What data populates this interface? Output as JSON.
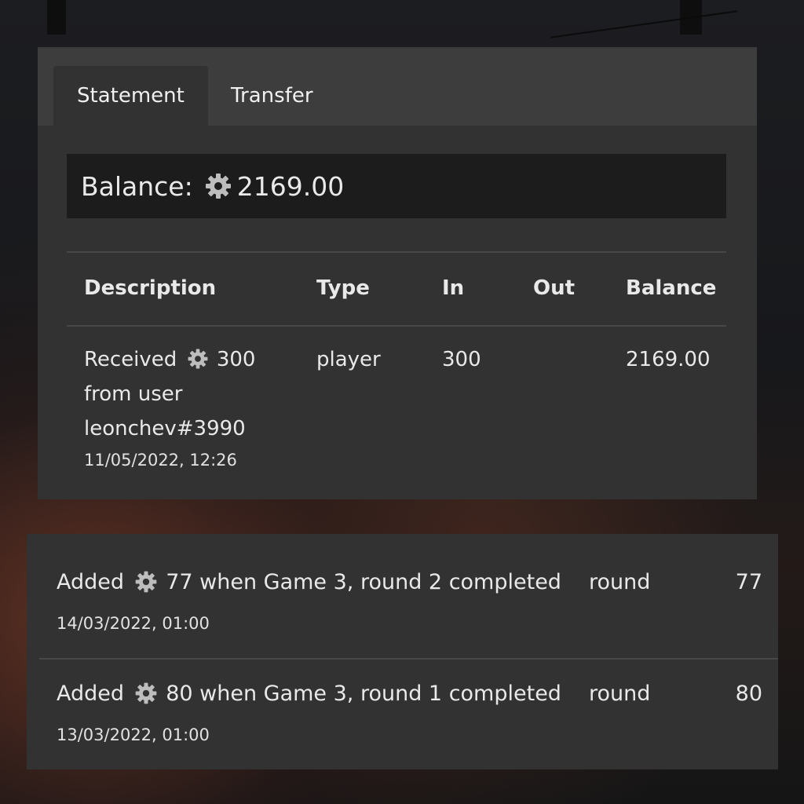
{
  "tabs": [
    {
      "label": "Statement",
      "active": true
    },
    {
      "label": "Transfer",
      "active": false
    }
  ],
  "balance": {
    "label": "Balance:",
    "icon": "gear-coin-icon",
    "amount": "2169.00"
  },
  "table": {
    "headers": {
      "description": "Description",
      "type": "Type",
      "in": "In",
      "out": "Out",
      "balance": "Balance"
    },
    "rows": [
      {
        "desc_prefix": "Received",
        "amount": "300",
        "desc_line2": "from user",
        "desc_line3": "leonchev#3990",
        "date": "11/05/2022, 12:26",
        "type": "player",
        "in": "300",
        "out": "",
        "balance": "2169.00"
      },
      {
        "desc_prefix": "Added",
        "desc_suffix": "77 when Game 3, round 2 completed",
        "date": "14/03/2022, 01:00",
        "type": "round",
        "in": "77"
      },
      {
        "desc_prefix": "Added",
        "desc_suffix": "80 when Game 3, round 1 completed",
        "date": "13/03/2022, 01:00",
        "type": "round",
        "in": "80"
      }
    ]
  },
  "colors": {
    "panel": "#323232",
    "tabbar": "#3d3d3d",
    "balance_box": "#1c1c1c",
    "text": "#e9e9e9"
  }
}
